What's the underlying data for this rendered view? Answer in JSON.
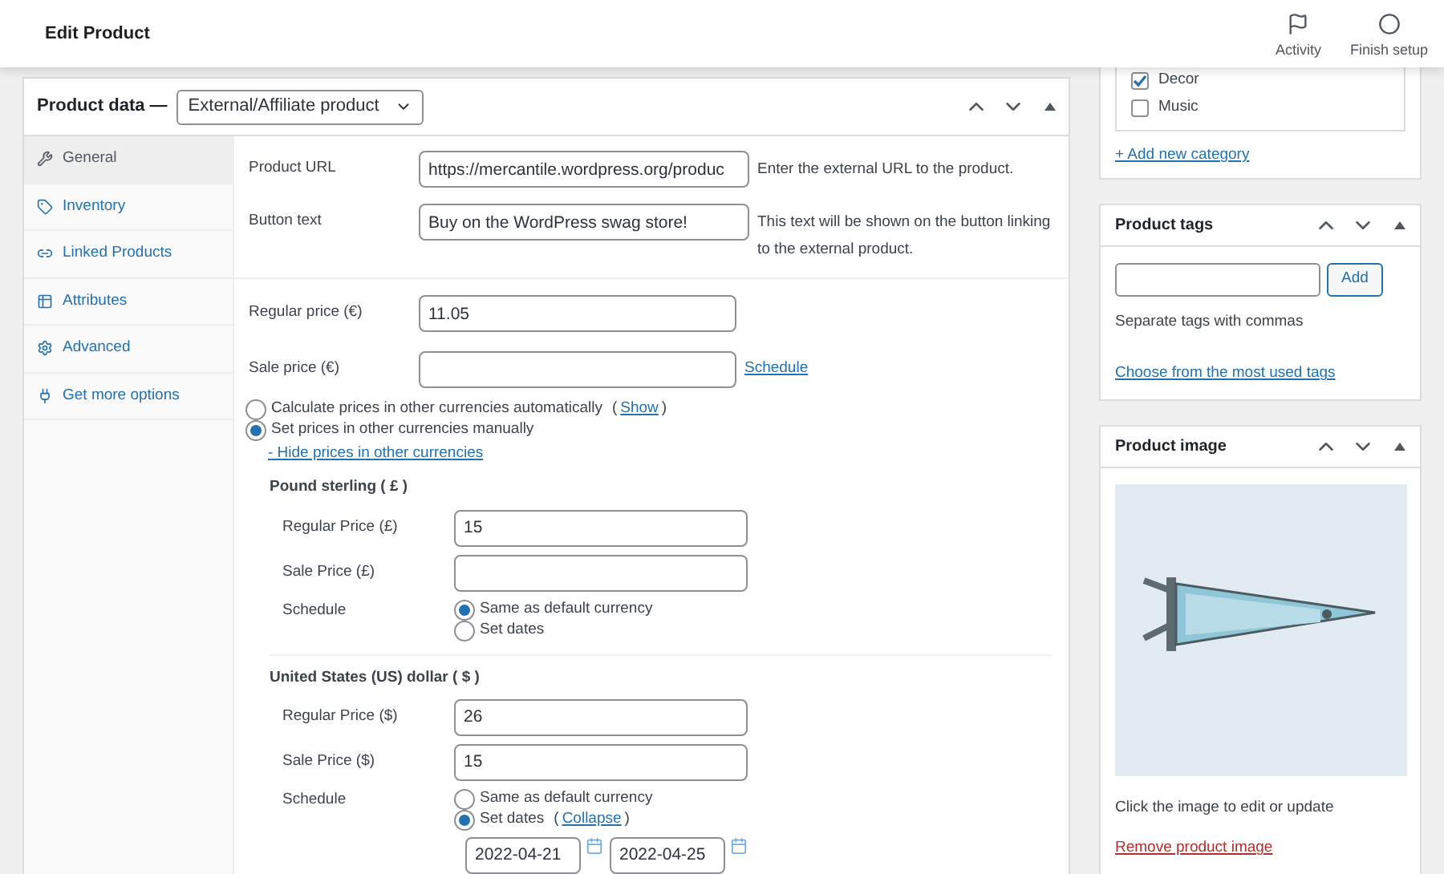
{
  "topbar": {
    "title": "Edit Product",
    "actions": [
      {
        "label": "Activity",
        "kind": "flag"
      },
      {
        "label": "Finish setup",
        "kind": "circle"
      }
    ]
  },
  "product_data": {
    "title": "Product data —",
    "type_select": "External/Affiliate product",
    "tabs": [
      {
        "label": "General",
        "selected": true
      },
      {
        "label": "Inventory",
        "selected": false
      },
      {
        "label": "Linked Products",
        "selected": false
      },
      {
        "label": "Attributes",
        "selected": false
      },
      {
        "label": "Advanced",
        "selected": false
      },
      {
        "label": "Get more options",
        "selected": false
      }
    ],
    "fields": [
      {
        "label": "Product URL",
        "value": "https://mercantile.wordpress.org/produc",
        "help": "Enter the external URL to the product."
      },
      {
        "label": "Button text",
        "value": "Buy on the WordPress swag store!",
        "help": "This text will be shown on the button linking to the external product."
      }
    ],
    "prices": [
      {
        "label": "Regular price (€)",
        "value": "11.05"
      },
      {
        "label": "Sale price (€)",
        "link": "Schedule"
      }
    ],
    "currency_mode": [
      {
        "label": "Calculate prices in other currencies automatically",
        "selected": false,
        "link_open": "(",
        "link": "Show",
        "link_close": ")"
      },
      {
        "label": "Set prices in other currencies manually",
        "selected": true
      }
    ],
    "hide_link": "- Hide prices in other currencies",
    "currencies": [
      {
        "name": "Pound sterling ( £ )",
        "fields": [
          {
            "label": "Regular Price (£)",
            "value": "15"
          },
          {
            "label": "Sale Price (£)"
          }
        ],
        "schedule_label": "Schedule",
        "schedule": [
          {
            "label": "Same as default currency",
            "selected": true
          },
          {
            "label": "Set dates",
            "selected": false
          }
        ]
      },
      {
        "name": "United States (US) dollar ( $ )",
        "fields": [
          {
            "label": "Regular Price ($)",
            "value": "26"
          },
          {
            "label": "Sale Price ($)",
            "value": "15"
          }
        ],
        "schedule_label": "Schedule",
        "schedule": [
          {
            "label": "Same as default currency",
            "selected": false
          },
          {
            "label": "Set dates",
            "selected": true,
            "link_open": "(",
            "link": "Collapse",
            "link_close": ")"
          }
        ],
        "dates": [
          "2022-04-21",
          "2022-04-25"
        ]
      }
    ]
  },
  "categories": {
    "items": [
      {
        "label": "Decor",
        "checked": true
      },
      {
        "label": "Music",
        "checked": false
      }
    ],
    "add_link": "+ Add new category"
  },
  "tags": {
    "title": "Product tags",
    "button": "Add",
    "hint": "Separate tags with commas",
    "link": "Choose from the most used tags"
  },
  "image": {
    "title": "Product image",
    "caption": "Click the image to edit or update",
    "remove_link": "Remove product image"
  }
}
